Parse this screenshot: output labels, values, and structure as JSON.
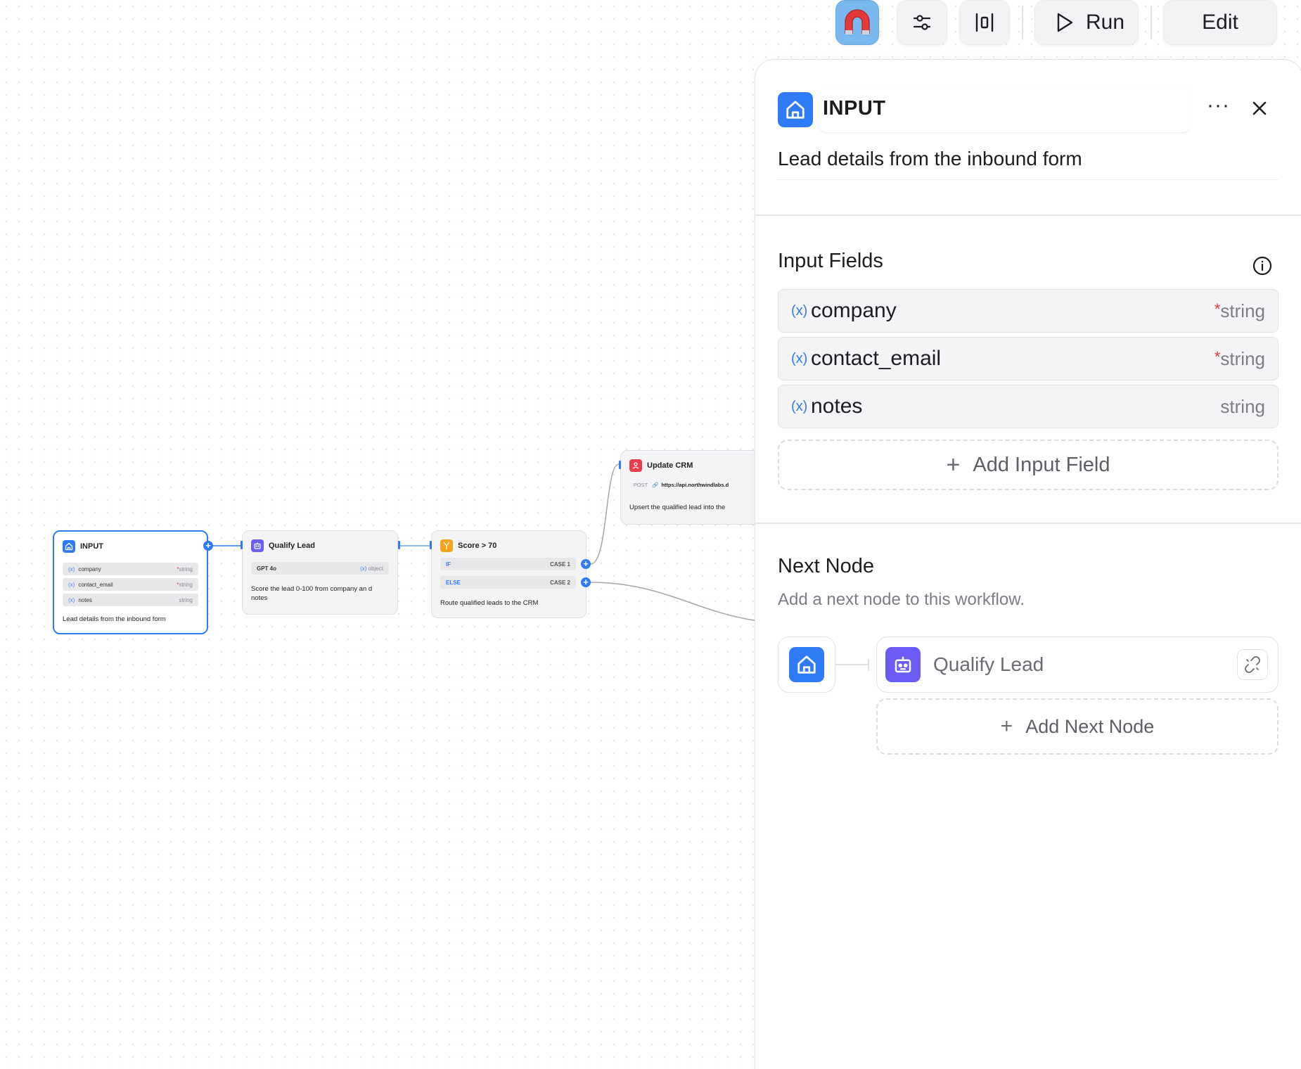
{
  "toolbar": {
    "run_label": "Run",
    "edit_label": "Edit",
    "magnet_icon": "magnet-icon",
    "settings_icon": "sliders-icon",
    "align_icon": "align-center-icon"
  },
  "canvas": {
    "input_node": {
      "title": "INPUT",
      "fields": [
        {
          "name": "company",
          "type": "string",
          "required": "*"
        },
        {
          "name": "contact_email",
          "type": "string",
          "required": "*"
        },
        {
          "name": "notes",
          "type": "string",
          "required": ""
        }
      ],
      "description": "Lead details from the inbound form"
    },
    "qualify_node": {
      "title": "Qualify Lead",
      "model": "GPT 4o",
      "output_type": "object",
      "description": "Score the lead 0-100 from company an d notes"
    },
    "condition_node": {
      "title": "Score > 70",
      "if_label": "IF",
      "if_case": "CASE 1",
      "else_label": "ELSE",
      "else_case": "CASE 2",
      "description": "Route qualified leads to the CRM"
    },
    "crm_node": {
      "title": "Update CRM",
      "method": "POST",
      "url": "https://api.northwindlabs.d",
      "description": "Upsert the qualified lead into the"
    }
  },
  "panel": {
    "title": "INPUT",
    "description": "Lead details from the inbound form",
    "input_fields_heading": "Input Fields",
    "fields": [
      {
        "name": "company",
        "type": "string",
        "required": "*"
      },
      {
        "name": "contact_email",
        "type": "string",
        "required": "*"
      },
      {
        "name": "notes",
        "type": "string",
        "required": ""
      }
    ],
    "add_input_field_label": "Add Input Field",
    "next_node_heading": "Next Node",
    "next_node_hint": "Add a next node to this workflow.",
    "next_node_name": "Qualify Lead",
    "add_next_node_label": "Add Next Node"
  },
  "colors": {
    "accent": "#2f7bf6",
    "llm": "#6a5cf5",
    "condition": "#f5a21c",
    "http": "#e43c4a",
    "required": "#e23a3a"
  }
}
